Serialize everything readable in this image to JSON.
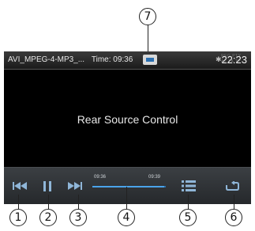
{
  "status_bar": {
    "file_name": "AVI_MPEG-4-MP3_...",
    "time_label": "Time: 09:36",
    "bt_symbol": "✱",
    "tuner_line1": "REG  PTY",
    "tuner_line2": "AF TA TP",
    "clock": "22:23"
  },
  "main": {
    "message": "Rear Source Control"
  },
  "playback": {
    "elapsed": "09:36",
    "total": "09:39",
    "progress_fraction": 0.98
  },
  "icons": {
    "usb": "usb-icon",
    "previous": "skip-previous-icon",
    "pause": "pause-icon",
    "next": "skip-next-icon",
    "list": "list-icon",
    "repeat": "repeat-icon"
  },
  "callouts": [
    "1",
    "2",
    "3",
    "4",
    "5",
    "6",
    "7"
  ],
  "colors": {
    "icon_blue": "#8fb6d8",
    "progress_blue": "#2b6da8"
  }
}
